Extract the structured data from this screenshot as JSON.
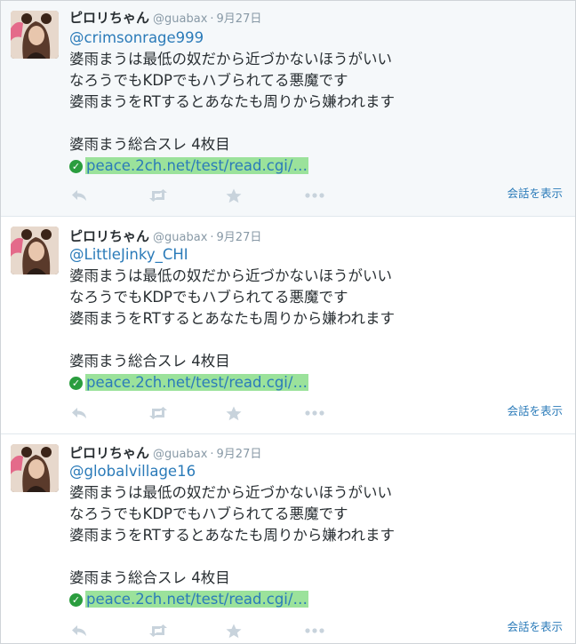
{
  "tweets": [
    {
      "fullname": "ピロリちゃん",
      "username": "@guabax",
      "separator": "·",
      "time": "9月27日",
      "mention": "@crimsonrage999",
      "lines": [
        "婆雨まうは最低の奴だから近づかないほうがいい",
        "なろうでもKDPでもハブられてる悪魔です",
        "婆雨まうをRTするとあなたも周りから嫌われます"
      ],
      "thread_title": "婆雨まう総合スレ 4枚目",
      "link_text": "peace.2ch.net/test/read.cgi/…",
      "conversation": "会話を表示",
      "icons": [
        "reply-icon",
        "retweet-icon",
        "favorite-icon",
        "more-icon"
      ]
    },
    {
      "fullname": "ピロリちゃん",
      "username": "@guabax",
      "separator": "·",
      "time": "9月27日",
      "mention": "@LittleJinky_CHI",
      "lines": [
        "婆雨まうは最低の奴だから近づかないほうがいい",
        "なろうでもKDPでもハブられてる悪魔です",
        "婆雨まうをRTするとあなたも周りから嫌われます"
      ],
      "thread_title": "婆雨まう総合スレ 4枚目",
      "link_text": "peace.2ch.net/test/read.cgi/…",
      "conversation": "会話を表示",
      "icons": [
        "reply-icon",
        "retweet-icon",
        "favorite-icon",
        "more-icon"
      ]
    },
    {
      "fullname": "ピロリちゃん",
      "username": "@guabax",
      "separator": "·",
      "time": "9月27日",
      "mention": "@globalvillage16",
      "lines": [
        "婆雨まうは最低の奴だから近づかないほうがいい",
        "なろうでもKDPでもハブられてる悪魔です",
        "婆雨まうをRTするとあなたも周りから嫌われます"
      ],
      "thread_title": "婆雨まう総合スレ 4枚目",
      "link_text": "peace.2ch.net/test/read.cgi/…",
      "conversation": "会話を表示",
      "icons": [
        "reply-icon",
        "retweet-icon",
        "favorite-icon",
        "more-icon"
      ]
    }
  ],
  "colors": {
    "link": "#2b7bb9",
    "text": "#292f33",
    "muted": "#8899a6",
    "highlight": "#9be29b",
    "verified_check": "#2a9d3e",
    "first_tweet_bg": "#f5f8fa"
  }
}
